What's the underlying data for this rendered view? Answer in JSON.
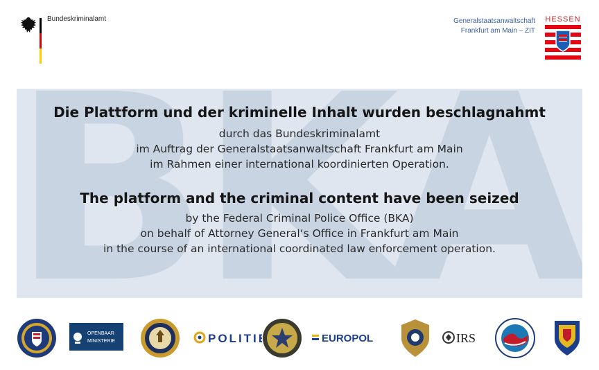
{
  "header": {
    "federal_office_name": "Bundeskriminalamt",
    "prosecutor_line1": "Generalstaatsanwaltschaft",
    "prosecutor_line2": "Frankfurt am Main – ZIT",
    "state_label": "HESSEN",
    "flag_colors": [
      "#000000",
      "#dd0000",
      "#ffce00"
    ]
  },
  "watermark": {
    "text": "BKA",
    "color": "#c9d4e2",
    "band_color": "#dfe6ef"
  },
  "german": {
    "heading": "Die Plattform und der kriminelle Inhalt wurden beschlagnahmt",
    "lines": [
      "durch das Bundeskriminalamt",
      "im Auftrag der Generalstaatsanwaltschaft Frankfurt am Main",
      "im Rahmen einer international koordinierten Operation."
    ]
  },
  "english": {
    "heading": "The platform and the criminal content have been seized",
    "lines": [
      "by the Federal Criminal Police Office (BKA)",
      "on behalf of Attorney General‘s Office in Frankfurt am Main",
      "in the course of an international coordinated law enforcement operation."
    ]
  },
  "partners": [
    {
      "id": "fbi",
      "icon": "fbi-seal-icon"
    },
    {
      "id": "om",
      "icon": "openbaar-ministerie-logo",
      "text_top": "OPENBAAR",
      "text_bottom": "MINISTERIE"
    },
    {
      "id": "doj",
      "icon": "doj-seal-icon"
    },
    {
      "id": "politie",
      "icon": "politie-logo",
      "text": "POLITIE"
    },
    {
      "id": "uspis",
      "icon": "postal-inspection-badge-icon"
    },
    {
      "id": "europol",
      "icon": "europol-logo",
      "text": "EUROPOL"
    },
    {
      "id": "hsi",
      "icon": "hsi-badge-icon"
    },
    {
      "id": "irs",
      "icon": "irs-logo",
      "text": "IRS"
    },
    {
      "id": "dea",
      "icon": "dea-seal-icon"
    },
    {
      "id": "romania",
      "icon": "romanian-police-crest-icon"
    }
  ]
}
